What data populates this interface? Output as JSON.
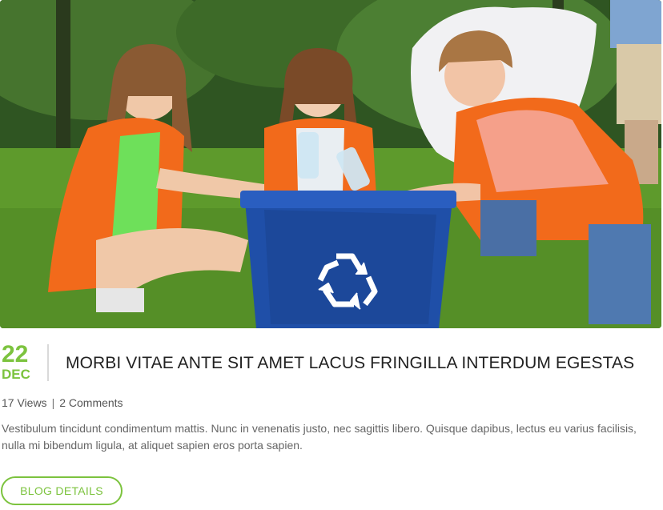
{
  "post": {
    "image": {
      "alt": "Children putting plastic bottles into a blue recycling bin on the grass",
      "icon": "recycle-icon"
    },
    "date": {
      "day": "22",
      "month": "DEC"
    },
    "title": "MORBI VITAE ANTE SIT AMET LACUS FRINGILLA INTERDUM EGESTAS",
    "meta": {
      "views": "17 Views",
      "separator": "|",
      "comments": "2 Comments"
    },
    "excerpt": "Vestibulum tincidunt condimentum mattis. Nunc in venenatis justo, nec sagittis libero. Quisque dapibus, lectus eu varius facilisis, nulla mi bibendum ligula, at aliquet sapien eros porta sapien.",
    "button_label": "BLOG DETAILS"
  },
  "colors": {
    "accent": "#7cc33e",
    "bin": "#1f4fa8",
    "vest": "#f26a1b",
    "grass": "#5e9a2c"
  }
}
